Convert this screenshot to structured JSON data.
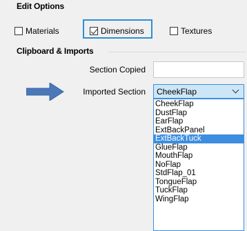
{
  "edit_options": {
    "heading": "Edit Options",
    "materials_label": "Materials",
    "dimensions_label": "Dimensions",
    "textures_label": "Textures",
    "materials_checked": false,
    "dimensions_checked": true,
    "textures_checked": false
  },
  "clipboard": {
    "heading": "Clipboard & Imports",
    "section_copied_label": "Section Copied",
    "section_copied_value": "",
    "imported_section_label": "Imported Section",
    "imported_section_value": "CheekFlap",
    "options": [
      "CheekFlap",
      "DustFlap",
      "EarFlap",
      "ExtBackPanel",
      "ExtBackTuck",
      "GlueFlap",
      "MouthFlap",
      "NoFlap",
      "StdFlap_01",
      "TongueFlap",
      "TuckFlap",
      "WingFlap"
    ],
    "highlighted_option": "ExtBackTuck"
  },
  "colors": {
    "accent": "#3d8ee0",
    "arrow": "#4a78b8",
    "focus": "#2b8fd6"
  }
}
